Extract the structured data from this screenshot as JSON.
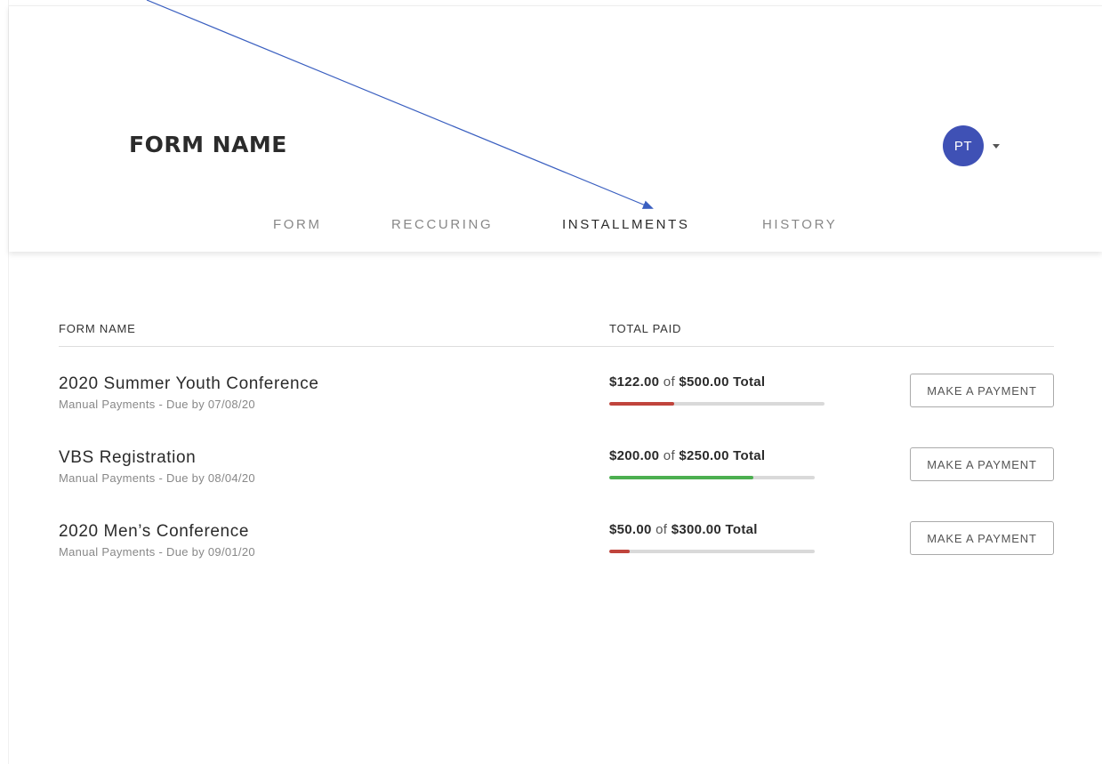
{
  "header": {
    "title": "FORM NAME",
    "user_initials": "PT"
  },
  "tabs": [
    {
      "label": "FORM",
      "active": false
    },
    {
      "label": "RECCURING",
      "active": false
    },
    {
      "label": "INSTALLMENTS",
      "active": true
    },
    {
      "label": "HISTORY",
      "active": false
    }
  ],
  "table": {
    "columns": [
      "FORM NAME",
      "TOTAL PAID"
    ],
    "rows": [
      {
        "name": "2020 Summer Youth Conference",
        "subtitle": "Manual Payments - Due by 07/08/20",
        "paid": "$122.00",
        "of": "of",
        "total": "$500.00 Total",
        "progress": 0.3,
        "bar_color": "#c0443c",
        "button": "MAKE A PAYMENT"
      },
      {
        "name": "VBS Registration",
        "subtitle": "Manual Payments - Due by 08/04/20",
        "paid": "$200.00",
        "of": "of",
        "total": "$250.00 Total",
        "progress": 0.7,
        "bar_color": "#4caf50",
        "button": "MAKE A PAYMENT"
      },
      {
        "name": "2020 Men’s Conference",
        "subtitle": "Manual Payments - Due by 09/01/20",
        "paid": "$50.00",
        "of": "of",
        "total": "$300.00 Total",
        "progress": 0.1,
        "bar_color": "#c0443c",
        "button": "MAKE A PAYMENT"
      }
    ]
  },
  "colors": {
    "avatar": "#3f51b5",
    "arrow": "#3a5fc0"
  }
}
